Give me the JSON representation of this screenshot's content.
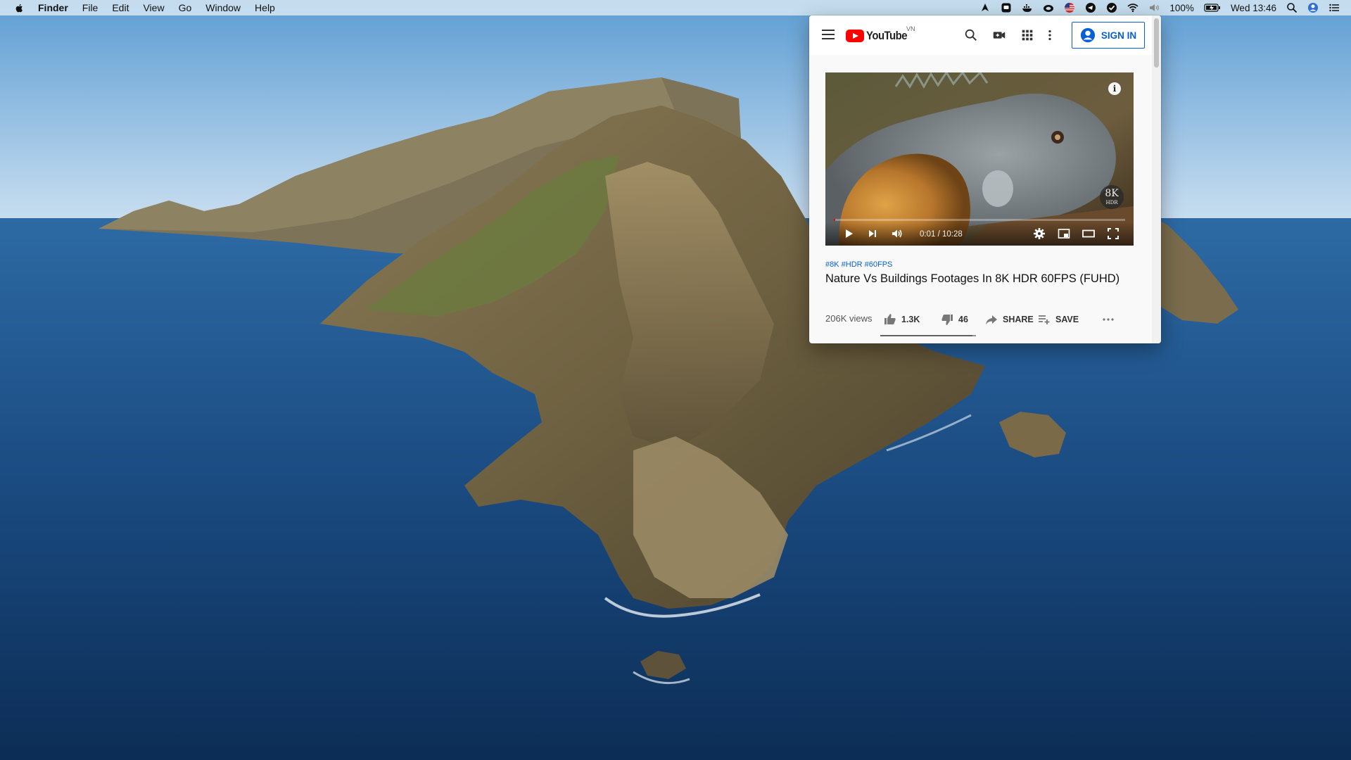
{
  "menubar": {
    "app_name": "Finder",
    "menus": [
      "File",
      "Edit",
      "View",
      "Go",
      "Window",
      "Help"
    ],
    "status_icons": [
      "pen-tool-icon",
      "screen-capture-icon",
      "docker-icon",
      "creative-cloud-icon",
      "us-flag-icon",
      "telegram-icon",
      "check-circle-icon",
      "wifi-icon",
      "volume-icon"
    ],
    "battery_percent": "100%",
    "clock": "Wed 13:46",
    "right_icons": [
      "spotlight-icon",
      "user-account-icon",
      "notification-center-icon"
    ]
  },
  "youtube": {
    "logo_text": "YouTube",
    "country_code": "VN",
    "header_icons": [
      "search-icon",
      "create-video-icon",
      "apps-grid-icon",
      "more-vert-icon"
    ],
    "sign_in_label": "SIGN IN",
    "player": {
      "current_time": "0:01",
      "duration": "10:28",
      "time_display": "0:01 / 10:28",
      "progress_fraction": 0.002,
      "badge_top": "8K",
      "badge_bottom": "HDR",
      "info_label": "i"
    },
    "video": {
      "tags": "#8K #HDR #60FPS",
      "title": "Nature Vs Buildings Footages In 8K HDR 60FPS (FUHD)",
      "views": "206K views",
      "likes": "1.3K",
      "dislikes": "46",
      "share_label": "SHARE",
      "save_label": "SAVE",
      "like_fraction": 0.966
    },
    "colors": {
      "brand_red": "#ff0000",
      "link_blue": "#065fd4"
    }
  }
}
